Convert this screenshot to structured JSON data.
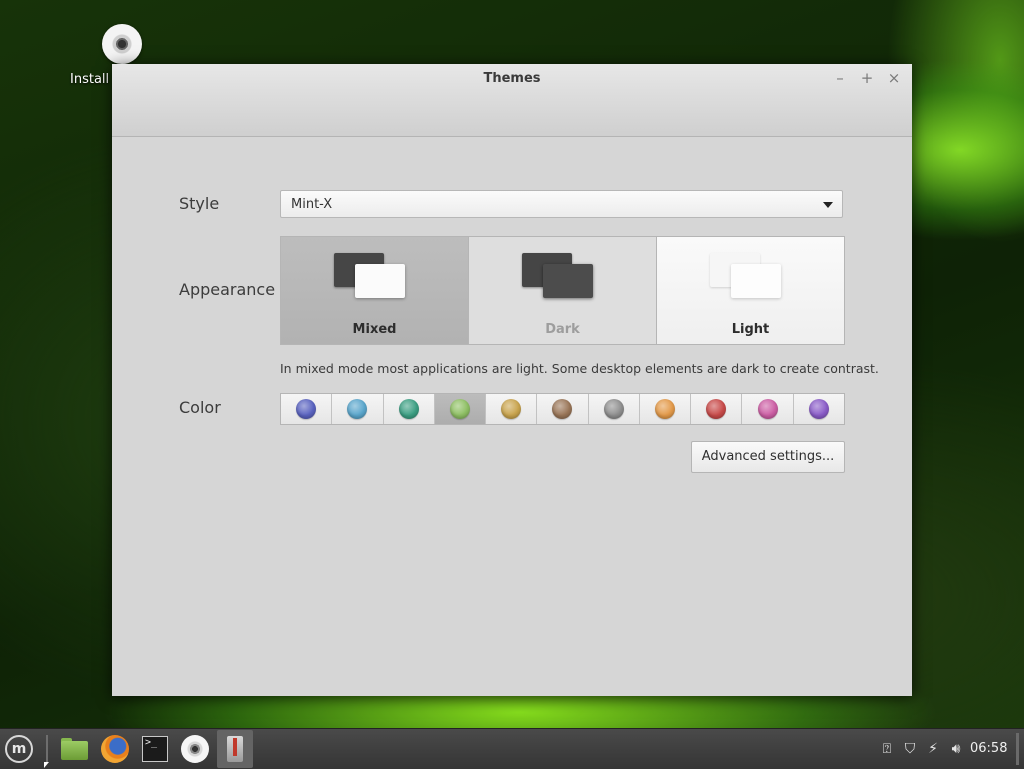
{
  "desktop": {
    "icons": [
      {
        "label": "Install",
        "icon": "disc-icon"
      }
    ]
  },
  "window": {
    "title": "Themes",
    "controls": {
      "minimize": "–",
      "maximize": "+",
      "close": "×"
    },
    "style": {
      "label": "Style",
      "selected": "Mint-X"
    },
    "appearance": {
      "label": "Appearance",
      "options": [
        {
          "name": "Mixed",
          "selected": true
        },
        {
          "name": "Dark",
          "selected": false
        },
        {
          "name": "Light",
          "selected": false
        }
      ],
      "description": "In mixed mode most applications are light. Some desktop elements are dark to create contrast."
    },
    "color": {
      "label": "Color",
      "swatches": [
        "#5a63c0",
        "#5aa6cc",
        "#3c9f83",
        "#8fc064",
        "#c9a44e",
        "#9a7658",
        "#8f8f8f",
        "#e39a4a",
        "#c84a49",
        "#cc5ea4",
        "#8a5cc8"
      ],
      "selected_index": 3
    },
    "advanced_label": "Advanced settings..."
  },
  "taskbar": {
    "launchers": [
      "menu-icon",
      "folder-icon",
      "firefox-icon",
      "terminal-icon",
      "disc-icon"
    ],
    "active_window_icon": "themes-icon",
    "tray_icons": [
      "update-icon",
      "shield-icon",
      "network-icon",
      "volume-icon"
    ],
    "clock": "06:58"
  }
}
